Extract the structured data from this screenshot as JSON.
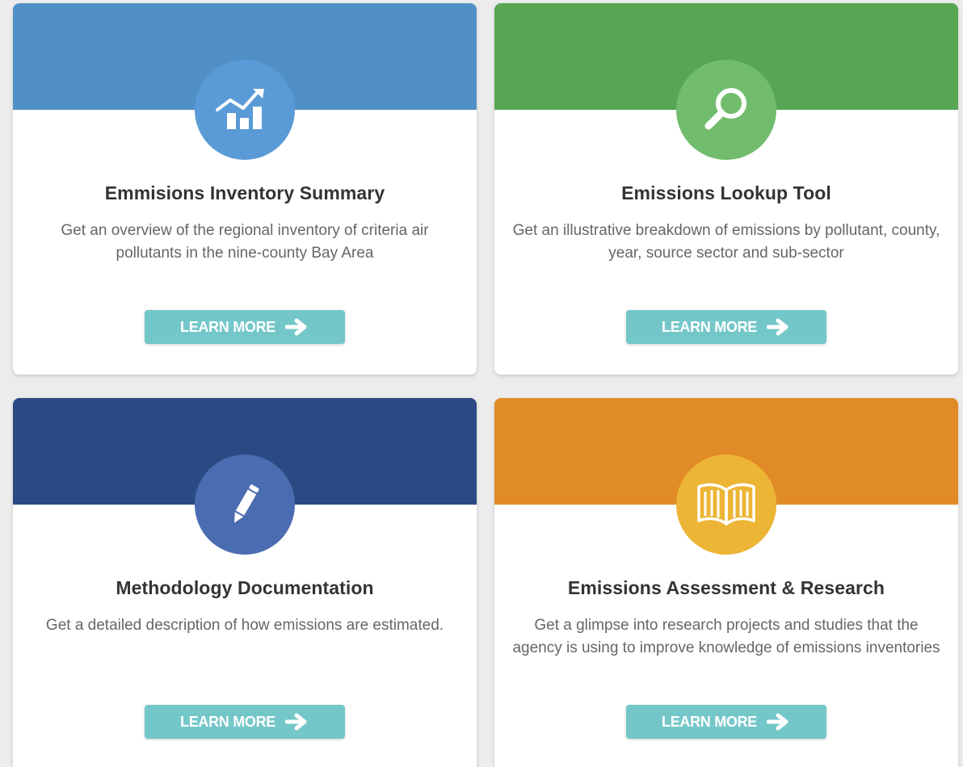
{
  "colors": {
    "band_blue": "#5190c6",
    "circle_blue": "#5a9ad6",
    "band_green": "#56a653",
    "circle_green": "#72bd6d",
    "band_navy": "#2b4a83",
    "circle_navy": "#4a6cb0",
    "band_orange": "#e08b27",
    "circle_yellow": "#ecb535",
    "button_teal": "#74c7c9"
  },
  "cards": [
    {
      "icon": "chart-icon",
      "title": "Emmisions Inventory Summary",
      "description": "Get an overview of the regional inventory of criteria air pollutants in the nine-county Bay Area",
      "button_label": "LEARN MORE"
    },
    {
      "icon": "magnifier-icon",
      "title": "Emissions Lookup Tool",
      "description": "Get an illustrative breakdown of emissions by pollutant, county, year, source sector and sub-sector",
      "button_label": "LEARN MORE"
    },
    {
      "icon": "pencil-icon",
      "title": "Methodology Documentation",
      "description": "Get a detailed description of how emissions are estimated.",
      "button_label": "LEARN MORE"
    },
    {
      "icon": "book-icon",
      "title": "Emissions Assessment & Research",
      "description": "Get a glimpse into research projects and studies that the agency is using to improve knowledge of emissions inventories",
      "button_label": "LEARN MORE"
    }
  ]
}
